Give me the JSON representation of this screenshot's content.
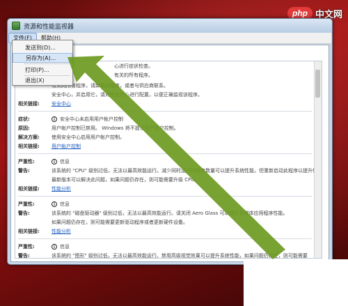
{
  "watermark": {
    "logo": "php",
    "text": "中文网"
  },
  "window": {
    "title": "资源和性能监视器"
  },
  "menu": {
    "items": [
      {
        "label": "文件(F)"
      },
      {
        "label": "帮助(H)"
      }
    ]
  },
  "file_menu": {
    "items": [
      {
        "label": "发送到(D)..."
      },
      {
        "label": "另存为(A)..."
      },
      {
        "label": "打印(P)..."
      },
      {
        "label": "退出(X)"
      }
    ]
  },
  "report": {
    "top_fragments": [
      "心进行症状检查。",
      "有关的所有程序。"
    ],
    "groups": [
      {
        "rows": [
          {
            "label": "",
            "value": "有关的所有程序，请卸载该程序，或者与供应商联系。"
          },
          {
            "label": "",
            "value": "安全中心，并启用它，请对安全中心进行配置，以便正确监视该程序。"
          },
          {
            "label": "相关链接:",
            "value": "安全中心",
            "type": "link"
          }
        ]
      },
      {
        "rows": [
          {
            "label": "症状:",
            "value": "安全中心未启用用户帐户控制",
            "type": "icon"
          },
          {
            "label": "原因:",
            "value": "用户帐户控制已禁用。 Windows 将不提示用户帐户控制。"
          },
          {
            "label": "解决方案:",
            "value": "使用安全中心启用用户帐户控制。"
          },
          {
            "label": "相关链接:",
            "value": "用户帐户控制",
            "type": "link"
          }
        ]
      },
      {
        "rows": [
          {
            "label": "严重性:",
            "value": "信息",
            "type": "icon"
          },
          {
            "label": "警告:",
            "value": "该系统的 \"CPU\" 级别过低，无法以最高效能运行。减少同时运行的程序数量可以提升系统性能，但重新启动此程序以提升性能。"
          },
          {
            "label": "",
            "value": "最新版本可以解决此问题，如果问题仍存在，则可能需要升级 CPU。"
          },
          {
            "label": "相关链接:",
            "value": "性能分析",
            "type": "link"
          }
        ]
      },
      {
        "rows": [
          {
            "label": "严重性:",
            "value": "信息",
            "type": "icon"
          },
          {
            "label": "警告:",
            "value": "该系统的 \"磁盘驱动器\" 级别过低，无法以最高效能运行。请关闭 Aero Glass 可以提升多媒体应用程序性能。"
          },
          {
            "label": "",
            "value": "如果问题仍存在，则可能需要更新驱动程序或者更新硬件设备。"
          },
          {
            "label": "相关链接:",
            "value": "性能分析",
            "type": "link"
          }
        ]
      },
      {
        "rows": [
          {
            "label": "严重性:",
            "value": "信息",
            "type": "icon"
          },
          {
            "label": "警告:",
            "value": "该系统的 \"图形\" 级别过低，无法以最高效能运行。禁用高级视觉效果可以提升系统性能，如果问题仍存在，则可能需要"
          },
          {
            "label": "",
            "value": "更新驱动程序或者更新硬件设备。"
          },
          {
            "label": "相关链接:",
            "value": "性能分析",
            "type": "link"
          }
        ]
      },
      {
        "rows": [
          {
            "label": "严重性:",
            "value": "信息",
            "type": "icon"
          }
        ]
      }
    ]
  },
  "colors": {
    "arrow": "#6c9a1f",
    "link": "#1f5fbf",
    "desktop": "#a01515"
  }
}
